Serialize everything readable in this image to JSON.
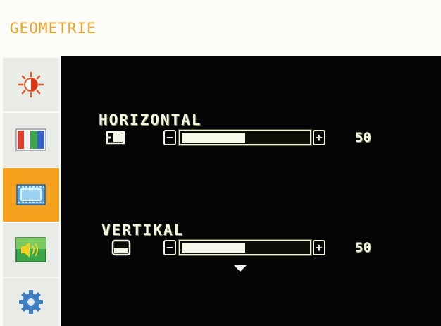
{
  "title": "GEOMETRIE",
  "sidebar": {
    "items": [
      {
        "icon": "brightness-icon",
        "active": false
      },
      {
        "icon": "color-bars-icon",
        "active": false
      },
      {
        "icon": "geometry-icon",
        "active": true
      },
      {
        "icon": "audio-icon",
        "active": false
      },
      {
        "icon": "gear-icon",
        "active": false
      }
    ]
  },
  "settings": [
    {
      "label": "HORIZONTAL",
      "icon": "horizontal-position-icon",
      "value": "50",
      "level": 0.5
    },
    {
      "label": "VERTIKAL",
      "icon": "vertical-position-icon",
      "value": "50",
      "level": 0.5
    }
  ],
  "colors": {
    "accent": "#f5a11d",
    "title": "#f0a020",
    "panel": "#050505",
    "sidebar": "#e9ebe6"
  }
}
